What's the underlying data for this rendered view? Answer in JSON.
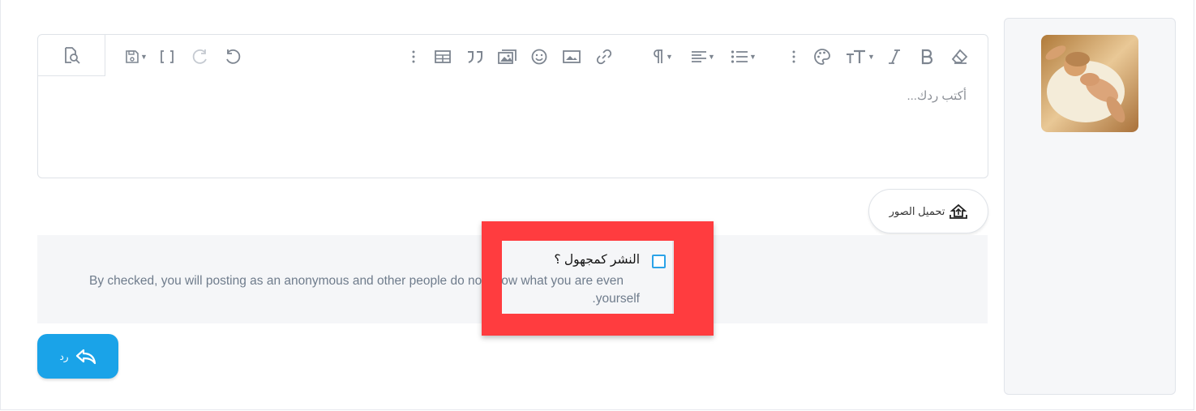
{
  "editor": {
    "placeholder": "أكتب ردك..."
  },
  "toolbar": {
    "icons": [
      "preview-icon",
      "save-draft-icon",
      "toggle-bbcode-icon",
      "redo-icon",
      "undo-icon",
      "more-options-icon",
      "table-icon",
      "quote-icon",
      "media-gallery-icon",
      "smilie-icon",
      "insert-image-icon",
      "link-icon",
      "paragraph-icon",
      "align-icon",
      "list-icon",
      "more-text-icon",
      "text-color-icon",
      "font-size-icon",
      "italic-icon",
      "bold-icon",
      "remove-format-icon"
    ]
  },
  "upload": {
    "label": "تحميل الصور"
  },
  "anonymous": {
    "label": "النشر كمجهول ؟",
    "checked": false,
    "hint_line1": "By checked, you will posting as an anonymous and other people do not know what you are even",
    "hint_line2": "yourself."
  },
  "reply": {
    "label": "رد"
  },
  "colors": {
    "accent": "#1aa3e8",
    "highlight": "#ff3c3f",
    "hint_text": "#6f7c8c"
  }
}
